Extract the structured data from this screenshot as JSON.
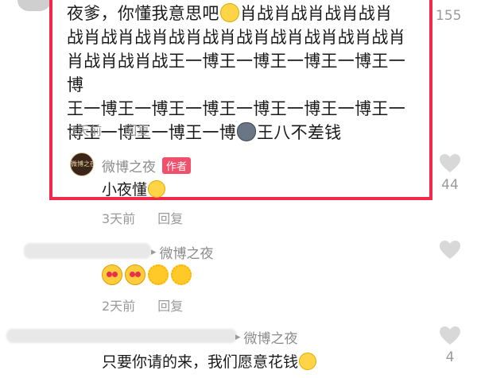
{
  "colors": {
    "highlight": "#f0284a",
    "author_tag_bg": "#f0506b",
    "meta": "#9a9a9a"
  },
  "comment": {
    "line1": "夜爹，你懂我意思吧",
    "line1_rest": "肖战肖战肖战肖战肖",
    "line2": "战肖战肖战肖战肖战肖战肖战肖战肖战肖战肖",
    "line3": "肖战肖战肖战王一博王一博王一博王一博王一博",
    "line4": "王一博王一博王一博王一博王一博王一博王一",
    "line5a": "博王一博王一博王一博",
    "line5b": "王八不差钱",
    "time": "3天前",
    "reply_label": "回复",
    "like_count": "155",
    "emoji1": "thinking-face-icon",
    "emoji2": "dog-face-icon"
  },
  "author_reply": {
    "avatar_text": "微博之夜",
    "name": "微博之夜",
    "tag": "作者",
    "text": "小夜懂",
    "time": "3天前",
    "reply_label": "回复",
    "like_count": "44"
  },
  "reply2": {
    "target": "微博之夜",
    "time": "2天前",
    "reply_label": "回复"
  },
  "reply3": {
    "target": "微博之夜",
    "text": "只要你请的来，我们愿意花钱",
    "like_count": "4"
  }
}
